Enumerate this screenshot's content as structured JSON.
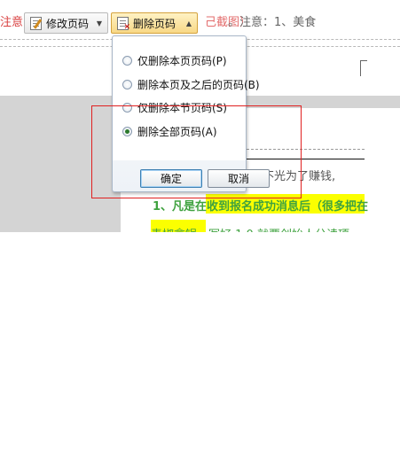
{
  "background_text": {
    "top_left": "注意",
    "top_mid": "己截图）",
    "top_right": "。注意：1、美食",
    "doc_line1": "全不光为了赚钱,",
    "doc_line2": "1、凡是在收到报名成功消息后（很多把在",
    "doc_line3": "青椒拿锅，写好 1.0 就要创始人分读项。"
  },
  "toolbar": {
    "edit_label": "修改页码",
    "delete_label": "删除页码"
  },
  "panel": {
    "options": [
      {
        "label": "仅删除本页页码(P)",
        "checked": false
      },
      {
        "label": "删除本页及之后的页码(B)",
        "checked": false
      },
      {
        "label": "仅删除本节页码(S)",
        "checked": false
      },
      {
        "label": "删除全部页码(A)",
        "checked": true
      }
    ],
    "ok_label": "确定",
    "cancel_label": "取消"
  },
  "colors": {
    "annotation_red": "#e02020",
    "highlight_yellow": "#fbff00",
    "doc_green": "#3fa23f"
  }
}
